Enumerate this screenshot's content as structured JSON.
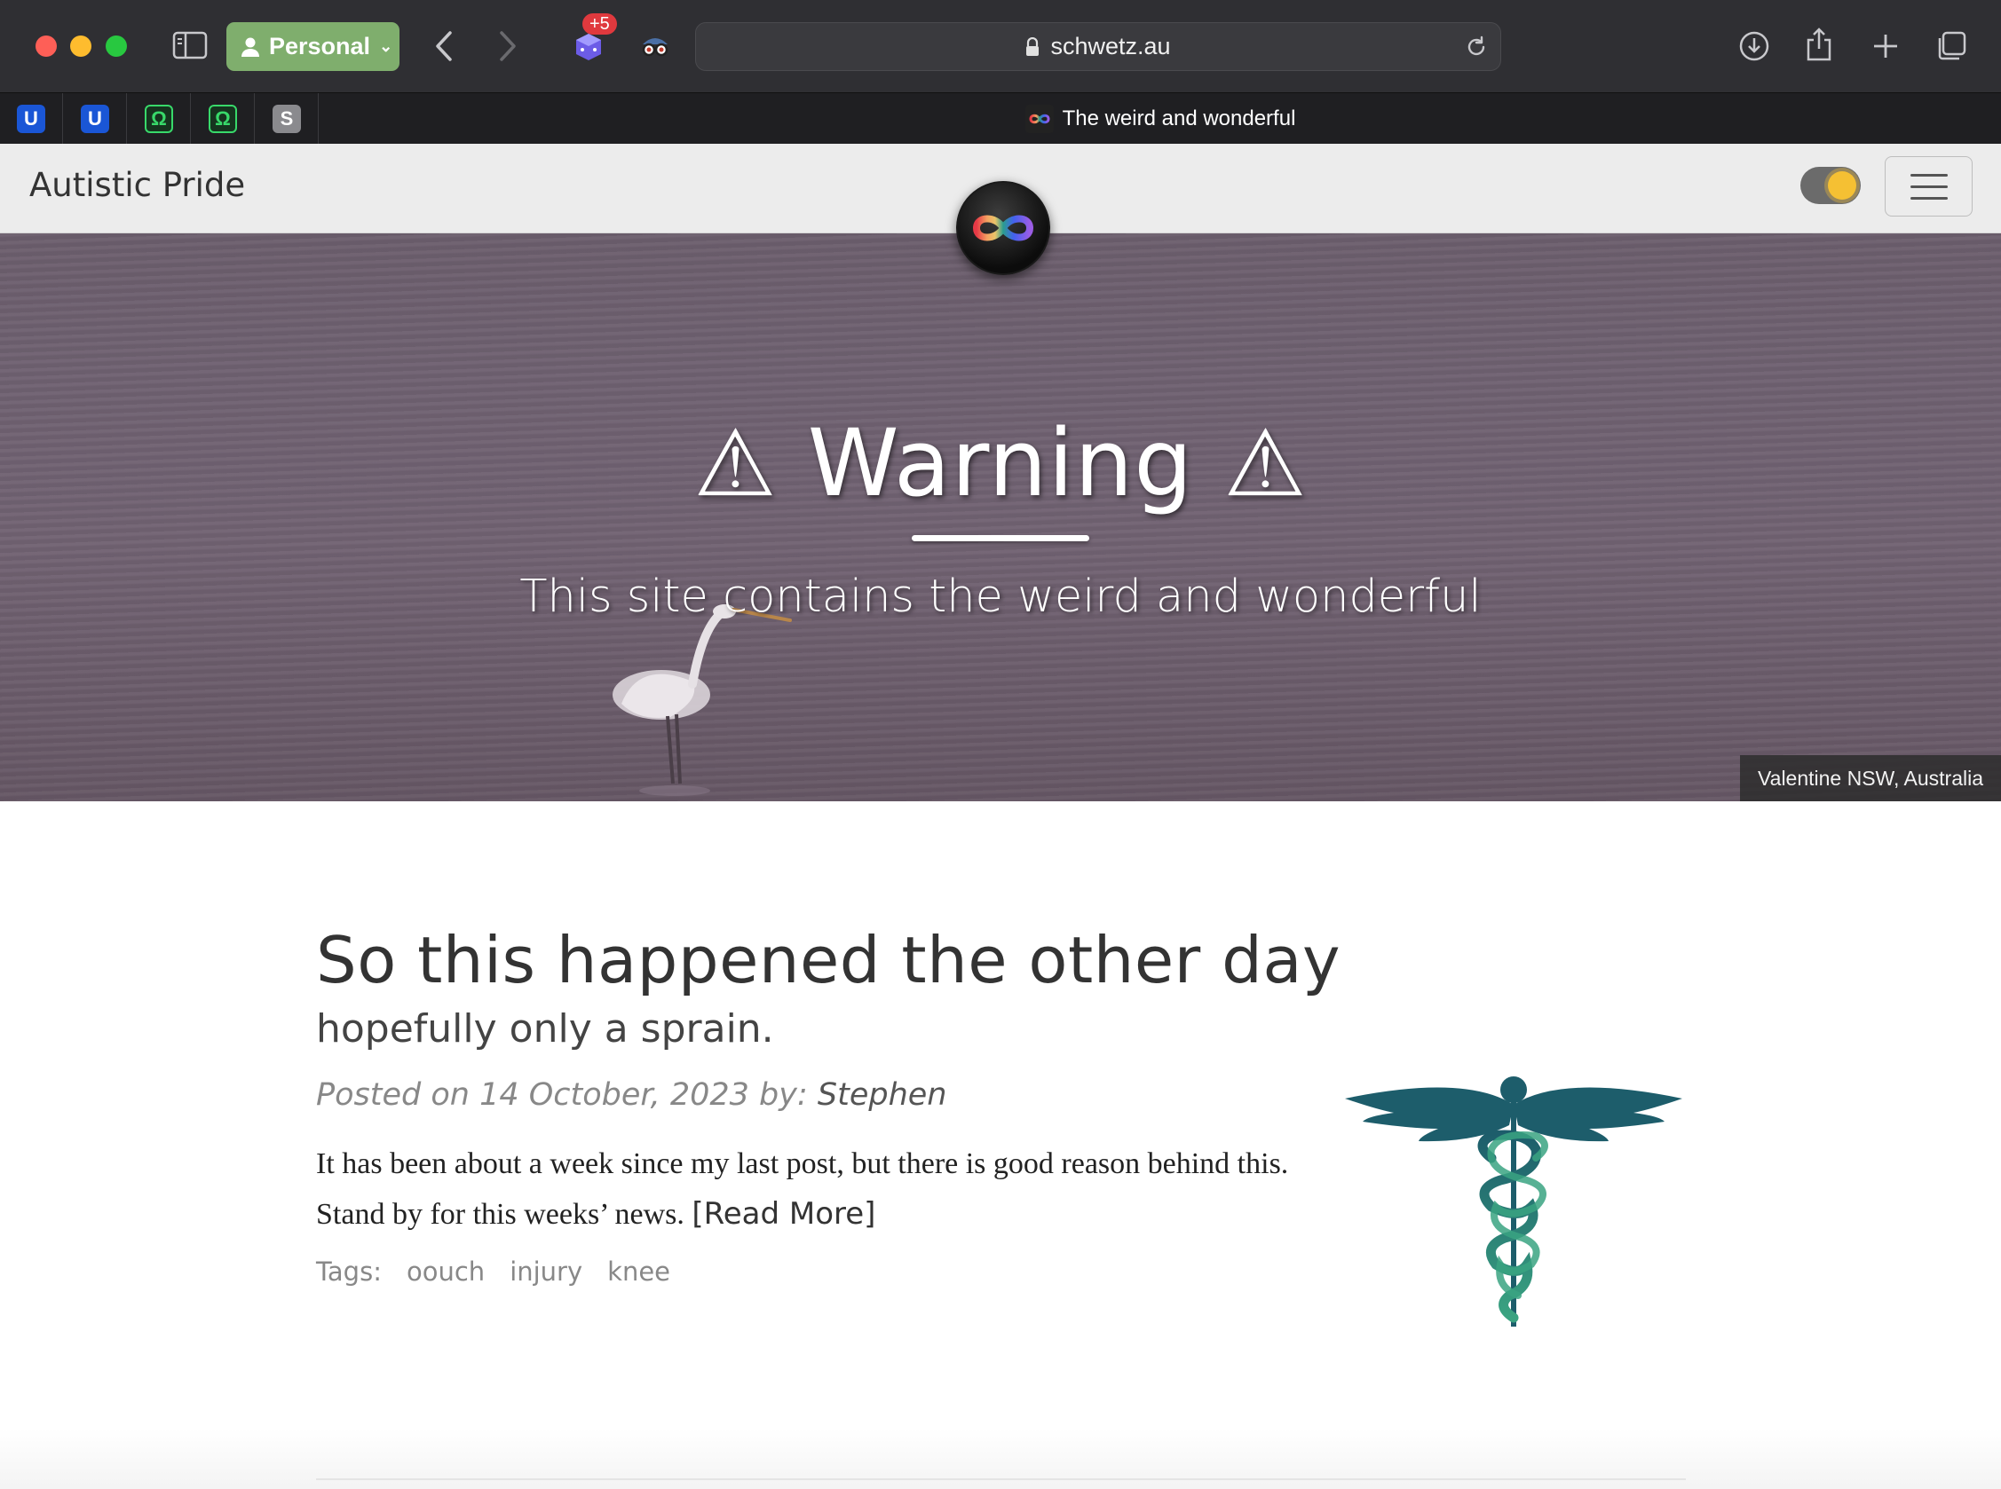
{
  "browser": {
    "profile_label": "Personal",
    "extension_badge": "+5",
    "url": "schwetz.au",
    "pinned_tabs": [
      "U",
      "U",
      "Ω",
      "Ω",
      "S"
    ],
    "active_tab_title": "The weird and wonderful"
  },
  "site": {
    "brand": "Autistic Pride",
    "hero": {
      "title": "⚠ Warning ⚠",
      "subtitle": "This site contains the weird and wonderful",
      "photo_caption": "Valentine NSW, Australia"
    },
    "post": {
      "title": "So this happened the other day",
      "subtitle": "hopefully only a sprain.",
      "meta_prefix": "Posted on 14 October, 2023 by: ",
      "author": "Stephen",
      "excerpt": "It has been about a week since my last post, but there is good reason behind this. Stand by for this weeks’ news. ",
      "read_more": "[Read More]",
      "tags_label": "Tags:",
      "tags": [
        "oouch",
        "injury",
        "knee"
      ]
    }
  },
  "colors": {
    "profile_green": "#7fae6d",
    "caduceus_teal": "#1d5d6b",
    "caduceus_green": "#3aa381"
  }
}
